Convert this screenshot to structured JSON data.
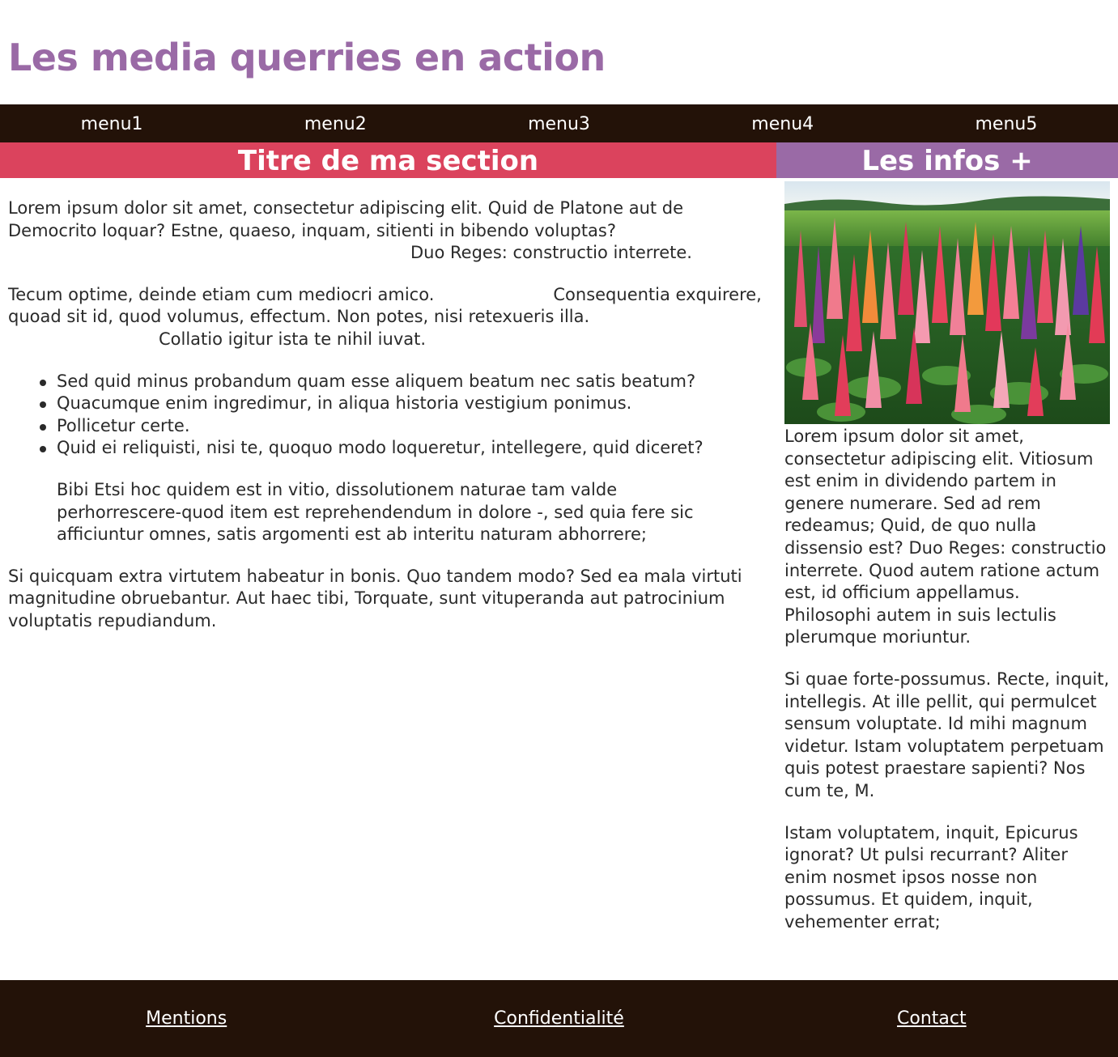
{
  "header": {
    "title": "Les media querries en action"
  },
  "nav": {
    "items": [
      "menu1",
      "menu2",
      "menu3",
      "menu4",
      "menu5"
    ]
  },
  "main": {
    "title": "Titre de ma section",
    "p1_text": "Lorem ipsum dolor sit amet, consectetur adipiscing elit. Quid de Platone aut de Democrito loquar? Estne, quaeso, inquam, sitienti in bibendo voluptas?",
    "p1_cite": "Duo Reges: constructio interrete.",
    "p2_text_a": "Tecum optime, deinde etiam cum mediocri amico.",
    "p2_text_b": "Consequentia exquirere, quoad sit id, quod volumus, effectum. Non potes, nisi retexueris illa.",
    "p2_cite": "Collatio igitur ista te nihil iuvat.",
    "list": [
      "Sed quid minus probandum quam esse aliquem beatum nec satis beatum?",
      "Quacumque enim ingredimur, in aliqua historia vestigium ponimus.",
      "Pollicetur certe.",
      "Quid ei reliquisti, nisi te, quoquo modo loqueretur, intellegere, quid diceret?"
    ],
    "list_quote": "Bibi Etsi hoc quidem est in vitio, dissolutionem naturae tam valde perhorrescere-quod item est reprehendendum in dolore -, sed quia fere sic afficiuntur omnes, satis argomenti est ab interitu naturam abhorrere;",
    "p3": "Si quicquam extra virtutem habeatur in bonis. Quo tandem modo? Sed ea mala virtuti magnitudine obruebantur. Aut haec tibi, Torquate, sunt vituperanda aut patrocinium voluptatis repudiandum."
  },
  "aside": {
    "title": "Les infos +",
    "image_icon": "lupin-flowers-photo",
    "paragraphs": [
      "Lorem ipsum dolor sit amet, consectetur adipiscing elit. Vitiosum est enim in dividendo partem in genere numerare. Sed ad rem redeamus; Quid, de quo nulla dissensio est? Duo Reges: constructio interrete. Quod autem ratione actum est, id officium appellamus. Philosophi autem in suis lectulis plerumque moriuntur.",
      "Si quae forte-possumus. Recte, inquit, intellegis. At ille pellit, qui permulcet sensum voluptate. Id mihi magnum videtur. Istam voluptatem perpetuam quis potest praestare sapienti? Nos cum te, M.",
      "Istam voluptatem, inquit, Epicurus ignorat? Ut pulsi recurrant? Aliter enim nosmet ipsos nosse non possumus. Et quidem, inquit, vehementer errat;"
    ]
  },
  "footer": {
    "links": [
      "Mentions",
      "Confidentialité",
      "Contact"
    ]
  },
  "colors": {
    "title_purple": "#9a6aa6",
    "section_red": "#db435d",
    "dark_brown": "#231208"
  }
}
